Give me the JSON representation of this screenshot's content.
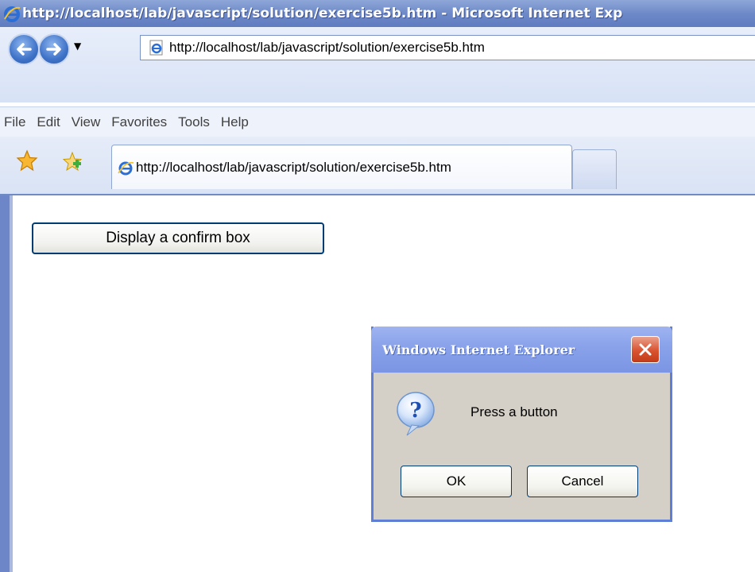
{
  "window": {
    "title": "http://localhost/lab/javascript/solution/exercise5b.htm - Microsoft Internet Exp"
  },
  "address_bar": {
    "url": "http://localhost/lab/javascript/solution/exercise5b.htm"
  },
  "menu": {
    "items": [
      "File",
      "Edit",
      "View",
      "Favorites",
      "Tools",
      "Help"
    ]
  },
  "tabs": [
    {
      "label": "http://localhost/lab/javascript/solution/exercise5b.htm",
      "icon": "ie-page-icon"
    }
  ],
  "page": {
    "confirm_button_label": "Display a confirm box"
  },
  "dialog": {
    "title": "Windows Internet Explorer",
    "message": "Press a button",
    "ok_label": "OK",
    "cancel_label": "Cancel",
    "icon": "question-icon"
  },
  "colors": {
    "title_bar": "#6e89c8",
    "dialog_title": "#8aa3ea",
    "dialog_body": "#d4d0c8",
    "close_button": "#d9532f"
  }
}
